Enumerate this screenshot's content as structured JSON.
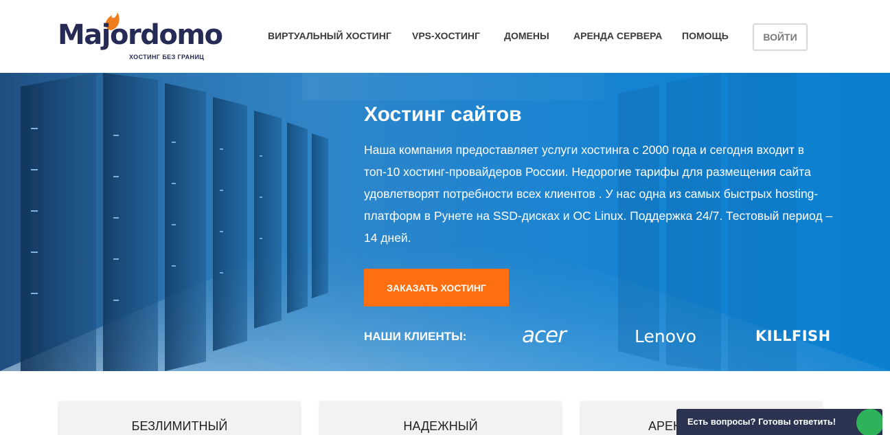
{
  "brand": {
    "name": "Majordomo",
    "tagline": "ХОСТИНГ БЕЗ ГРАНИЦ"
  },
  "nav": {
    "items": [
      {
        "label": "ВИРТУАЛЬНЫЙ ХОСТИНГ"
      },
      {
        "label": "VPS-ХОСТИНГ"
      },
      {
        "label": "ДОМЕНЫ"
      },
      {
        "label": "АРЕНДА СЕРВЕРА"
      },
      {
        "label": "ПОМОЩЬ"
      }
    ],
    "login_label": "ВОЙТИ"
  },
  "hero": {
    "title": "Хостинг сайтов",
    "text": "Наша компания предоставляет услуги хостинга с 2000 года и сегодня входит в топ-10 хостинг-провайдеров России. Недорогие тарифы для размещения сайта удовлетворят потребности всех клиентов . У нас одна из самых быстрых hosting-платформ в Рунете на SSD-дисках и ОС Linux. Поддержка 24/7. Тестовый период – 14 дней.",
    "cta_label": "ЗАКАЗАТЬ ХОСТИНГ",
    "clients_label": "НАШИ КЛИЕНТЫ:",
    "clients": [
      "acer",
      "Lenovo",
      "KILLFISH"
    ]
  },
  "cards": [
    {
      "title": "БЕЗЛИМИТНЫЙ"
    },
    {
      "title": "НАДЕЖНЫЙ"
    },
    {
      "title": "АРЕН"
    }
  ],
  "chat": {
    "label": "Есть вопросы? Готовы ответить!"
  },
  "colors": {
    "brand_navy": "#262b55",
    "accent_orange": "#ff6f0f",
    "hero_blue": "#1b86d4",
    "chat_bg": "#2b3350",
    "chat_green": "#2fb35a"
  }
}
